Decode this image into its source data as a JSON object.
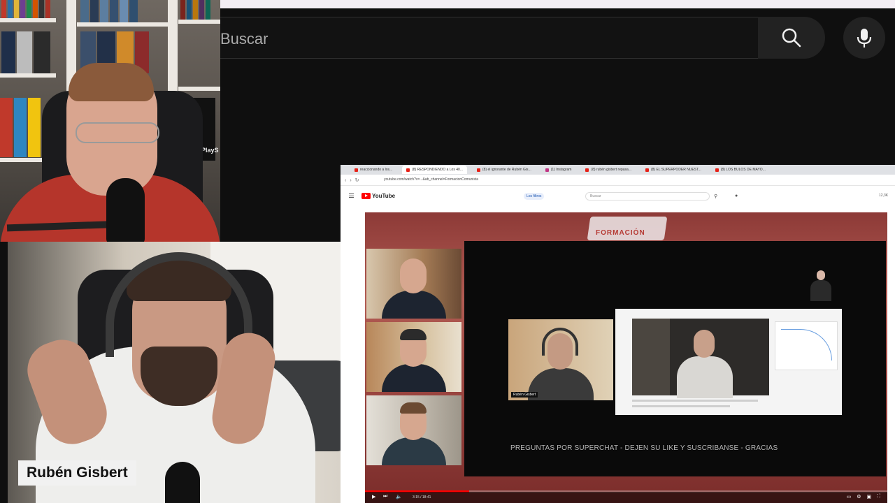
{
  "youtube": {
    "search_placeholder": "Buscar"
  },
  "webcams": {
    "guest_name": "Rubén Gisbert",
    "bookshelf_label": "PlayS"
  },
  "nested_browser": {
    "tabs": [
      {
        "label": "reaccionando a los...",
        "active": false
      },
      {
        "label": "(8) RESPONDIENDO a Los 40...",
        "active": true
      },
      {
        "label": "(8) el ignorante de Rubén Gis...",
        "active": false
      },
      {
        "label": "(1) Instagram",
        "active": false
      },
      {
        "label": "(8) rubén gisbert repasa...",
        "active": false
      },
      {
        "label": "(8) EL SUPERPODER NUEST...",
        "active": false
      },
      {
        "label": "(8) LOS BULOS DE MAYO...",
        "active": false
      }
    ],
    "url": "youtube.com/watch?v=...&ab_channel=FormacionComunista",
    "search_placeholder": "Buscar",
    "filter_chip": "Los filtros",
    "notif_count": "12,3K",
    "logo_text": "YouTube",
    "banner_text": "FORMACIÓN",
    "inner_cam_label": "Rubén Gisbert",
    "ticker_text": "PREGUNTAS POR SUPERCHAT - DEJEN SU LIKE Y SUSCRIBANSE - GRACIAS",
    "time_display": "3:15 / 18:41",
    "progress_fraction": 0.2
  },
  "colors": {
    "yt_red": "#ff0000",
    "background": "#0f0f0f",
    "shirt_red": "#b5352b",
    "video_maroon": "#9b4540"
  },
  "icons": [
    "search-icon",
    "microphone-icon",
    "play-icon",
    "next-icon",
    "volume-icon",
    "settings-icon",
    "fullscreen-icon"
  ]
}
